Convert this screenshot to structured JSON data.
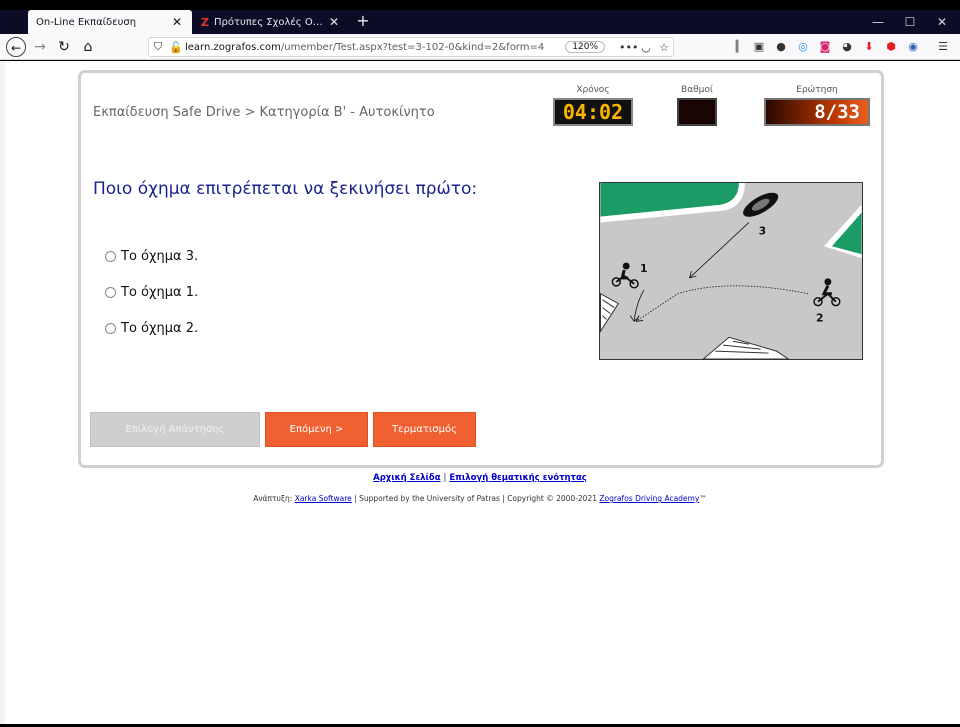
{
  "browser": {
    "tabs": [
      {
        "title": "On-Line Εκπαίδευση",
        "active": true
      },
      {
        "title": "Πρότυπες Σχολές Οδηγών Ζω",
        "active": false
      }
    ],
    "url_host": "learn.zografos.com",
    "url_path": "/umember/Test.aspx?test=3-102-0&kind=2&form=4",
    "zoom": "120%"
  },
  "quiz": {
    "breadcrumb": "Εκπαίδευση Safe Drive > Κατηγορία Β' - Αυτοκίνητο",
    "timer_label": "Χρόνος",
    "timer_value": "04:02",
    "score_label": "Βαθμοί",
    "score_value": "",
    "question_label": "Ερώτηση",
    "question_counter": "8/33",
    "question_text": "Ποιο όχημα επιτρέπεται να ξεκινήσει πρώτο:",
    "options": [
      "Το όχημα 3.",
      "Το όχημα 1.",
      "Το όχημα 2."
    ],
    "diagram_labels": [
      "1",
      "2",
      "3"
    ],
    "buttons": {
      "select_answer": "Επιλογή Απάντησης",
      "next": "Επόμενη >",
      "end": "Τερματισμός"
    }
  },
  "footer": {
    "home_link": "Αρχική Σελίδα",
    "separator": "|",
    "topic_link": "Επιλογή θεματικής ενότητας",
    "dev_prefix": "Ανάπτυξη:",
    "dev_link": "Xarka Software",
    "supported": "| Supported by the University of Patras | Copyright © 2000-2021",
    "academy_link": "Zografos Driving Academy",
    "tm": "™"
  },
  "colors": {
    "question_text": "#1a238c",
    "accent_button": "#f06030",
    "timer_digits": "#ffb400",
    "road_green": "#1a9c64"
  }
}
